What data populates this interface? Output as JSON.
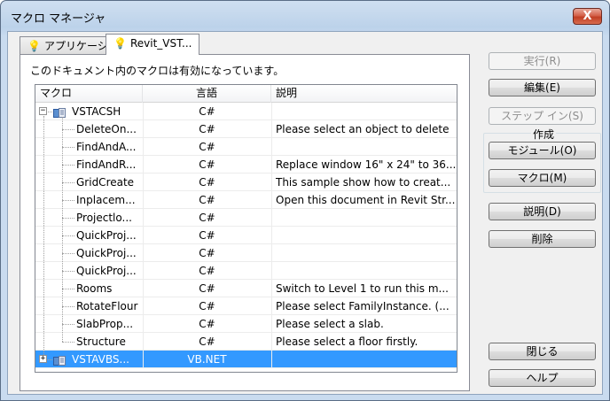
{
  "window": {
    "title": "マクロ マネージャ",
    "close_label": "X"
  },
  "tabs": [
    {
      "label": "アプリケーション",
      "icon": "bulb-icon"
    },
    {
      "label": "Revit_VST...",
      "icon": "bulb-icon"
    }
  ],
  "panel": {
    "caption": "このドキュメント内のマクロは有効になっています。"
  },
  "grid": {
    "columns": [
      "マクロ",
      "言語",
      "説明"
    ],
    "rows": [
      {
        "name": "VSTACSH",
        "lang": "C#",
        "desc": "",
        "level": 0,
        "expander": "−"
      },
      {
        "name": "DeleteOn...",
        "lang": "C#",
        "desc": "Please select an object to delete",
        "level": 1
      },
      {
        "name": "FindAndA...",
        "lang": "C#",
        "desc": "",
        "level": 1
      },
      {
        "name": "FindAndR...",
        "lang": "C#",
        "desc": "Replace window 16\" x 24\" to 36...",
        "level": 1
      },
      {
        "name": "GridCreate",
        "lang": "C#",
        "desc": "This sample show how to creat...",
        "level": 1
      },
      {
        "name": "Inplacem...",
        "lang": "C#",
        "desc": "Open this document in Revit Str...",
        "level": 1
      },
      {
        "name": "Projectlo...",
        "lang": "C#",
        "desc": "",
        "level": 1
      },
      {
        "name": "QuickProj...",
        "lang": "C#",
        "desc": "",
        "level": 1
      },
      {
        "name": "QuickProj...",
        "lang": "C#",
        "desc": "",
        "level": 1
      },
      {
        "name": "QuickProj...",
        "lang": "C#",
        "desc": "",
        "level": 1
      },
      {
        "name": "Rooms",
        "lang": "C#",
        "desc": "Switch to Level 1 to run this m...",
        "level": 1
      },
      {
        "name": "RotateFlour",
        "lang": "C#",
        "desc": "Please select FamilyInstance. (...",
        "level": 1
      },
      {
        "name": "SlabProp...",
        "lang": "C#",
        "desc": "Please select a slab.",
        "level": 1
      },
      {
        "name": "Structure",
        "lang": "C#",
        "desc": "Please select a floor firstly.",
        "level": 1
      },
      {
        "name": "VSTAVBS...",
        "lang": "VB.NET",
        "desc": "",
        "level": 0,
        "expander": "+",
        "selected": true
      }
    ]
  },
  "buttons": {
    "run": "実行(R)",
    "edit": "編集(E)",
    "step_in": "ステップ イン(S)",
    "create_group": "作成",
    "module": "モジュール(O)",
    "macro": "マクロ(M)",
    "description": "説明(D)",
    "delete": "削除",
    "close": "閉じる",
    "help": "ヘルプ"
  },
  "colors": {
    "selection": "#3399ff",
    "bulb": "#e8b80c"
  }
}
